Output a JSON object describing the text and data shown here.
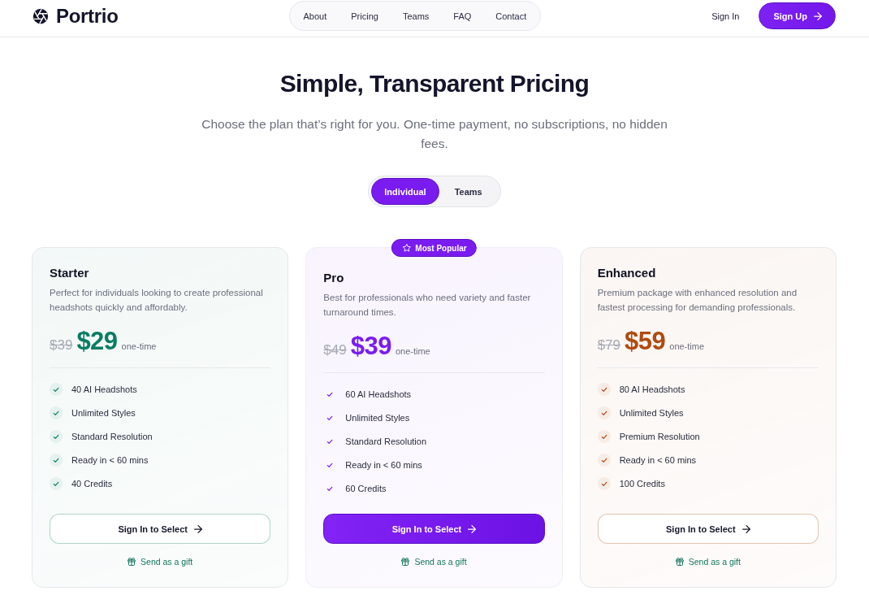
{
  "header": {
    "logo": "Portrio",
    "nav": [
      "About",
      "Pricing",
      "Teams",
      "FAQ",
      "Contact"
    ],
    "sign_in": "Sign In",
    "sign_up": "Sign Up"
  },
  "hero": {
    "title": "Simple, Transparent Pricing",
    "subtitle": "Choose the plan that’s right for you. One-time payment, no subscriptions, no hidden fees."
  },
  "plan_toggle": [
    {
      "label": "Individual",
      "selected": true
    },
    {
      "label": "Teams",
      "selected": false
    }
  ],
  "plans": [
    {
      "name": "Starter",
      "description": "Perfect for individuals looking to create professional headshots quickly and affordably.",
      "old_price": "$39",
      "price": "$29",
      "price_note": "one-time",
      "features": [
        "40 AI Headshots",
        "Unlimited Styles",
        "Standard Resolution",
        "Ready in < 60 mins",
        "40 Credits"
      ],
      "button": "Sign In to Select",
      "gift_link": "Send as a gift",
      "color": "#0a7d64",
      "highlighted": false
    },
    {
      "name": "Pro",
      "badge": "Most Popular",
      "description": "Best for professionals who need variety and faster turnaround times.",
      "old_price": "$49",
      "price": "$39",
      "price_note": "one-time",
      "features": [
        "60 AI Headshots",
        "Unlimited Styles",
        "Standard Resolution",
        "Ready in < 60 mins",
        "60 Credits"
      ],
      "button": "Sign In to Select",
      "gift_link": "Send as a gift",
      "color": "#7a1cf0",
      "highlighted": true
    },
    {
      "name": "Enhanced",
      "description": "Premium package with enhanced resolution and fastest processing for demanding professionals.",
      "old_price": "$79",
      "price": "$59",
      "price_note": "one-time",
      "features": [
        "80 AI Headshots",
        "Unlimited Styles",
        "Premium Resolution",
        "Ready in < 60 mins",
        "100 Credits"
      ],
      "button": "Sign In to Select",
      "gift_link": "Send as a gift",
      "color": "#b04a10",
      "highlighted": false
    }
  ]
}
